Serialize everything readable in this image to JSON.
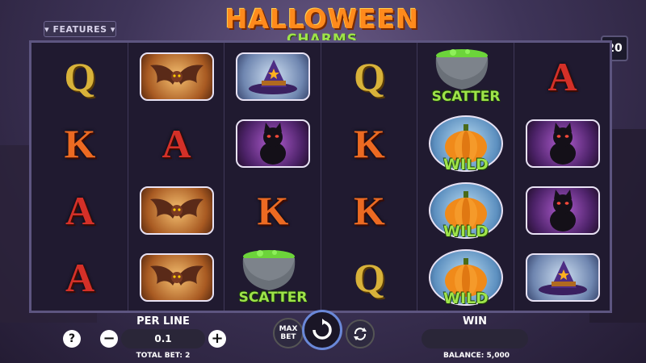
{
  "header": {
    "features_label": "▾ FEATURES ▾",
    "logo_line1": "HALLOWEEN",
    "logo_line2": "CHARMS",
    "paylines": "20"
  },
  "reels": [
    [
      {
        "type": "letter",
        "value": "Q"
      },
      {
        "type": "letter",
        "value": "K"
      },
      {
        "type": "letter",
        "value": "A"
      },
      {
        "type": "letter",
        "value": "A"
      }
    ],
    [
      {
        "type": "tile",
        "value": "bat"
      },
      {
        "type": "letter",
        "value": "A"
      },
      {
        "type": "tile",
        "value": "bat"
      },
      {
        "type": "tile",
        "value": "bat"
      }
    ],
    [
      {
        "type": "tile",
        "value": "hat"
      },
      {
        "type": "tile",
        "value": "cat"
      },
      {
        "type": "letter",
        "value": "K"
      },
      {
        "type": "cauldron",
        "value": "SCATTER"
      }
    ],
    [
      {
        "type": "letter",
        "value": "Q"
      },
      {
        "type": "letter",
        "value": "K"
      },
      {
        "type": "letter",
        "value": "K"
      },
      {
        "type": "letter",
        "value": "Q"
      }
    ],
    [
      {
        "type": "cauldron",
        "value": "SCATTER"
      },
      {
        "type": "pumpkin",
        "value": "WILD"
      },
      {
        "type": "pumpkin",
        "value": "WILD"
      },
      {
        "type": "pumpkin",
        "value": "WILD"
      }
    ],
    [
      {
        "type": "letter",
        "value": "A"
      },
      {
        "type": "tile",
        "value": "cat"
      },
      {
        "type": "tile",
        "value": "cat"
      },
      {
        "type": "tile",
        "value": "hat"
      }
    ]
  ],
  "controls": {
    "help": "?",
    "per_line_label": "PER LINE",
    "per_line_value": "0.1",
    "minus": "−",
    "plus": "+",
    "total_bet": "TOTAL BET: 2",
    "max_bet": "MAX BET",
    "win_label": "WIN",
    "balance": "BALANCE: 5,000"
  },
  "colors": {
    "accent": "#ff8a1c",
    "wild": "#9ee34a",
    "frame": "#5d5580"
  }
}
